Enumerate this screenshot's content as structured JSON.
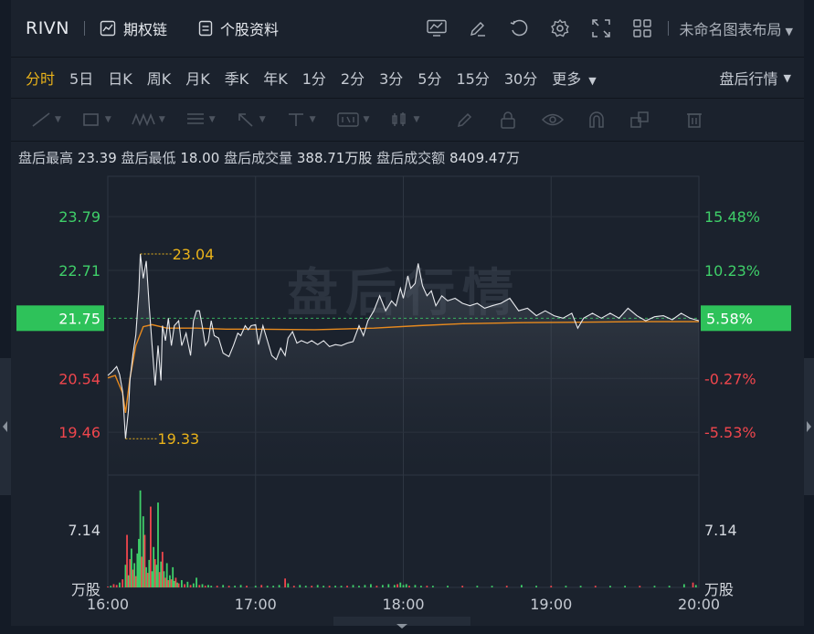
{
  "header": {
    "symbol": "RIVN",
    "options_chain": "期权链",
    "profile": "个股资料",
    "layout_name": "未命名图表布局",
    "icons": [
      "chart-icon",
      "edit-icon",
      "refresh-icon",
      "gear-icon",
      "fullscreen-icon",
      "grid-icon"
    ]
  },
  "periods": {
    "items": [
      "分时",
      "5日",
      "日K",
      "周K",
      "月K",
      "季K",
      "年K",
      "1分",
      "2分",
      "3分",
      "5分",
      "15分",
      "30分"
    ],
    "active": "分时",
    "more": "更多",
    "session": "盘后行情"
  },
  "tools": [
    "line-tool-icon",
    "rect-tool-icon",
    "wave-tool-icon",
    "fib-tool-icon",
    "arrow-tool-icon",
    "text-tool-icon",
    "number-tool-icon",
    "candle-tool-icon",
    "pen-icon",
    "lock-icon",
    "eye-icon",
    "magnet-icon",
    "layers-icon",
    "trash-icon"
  ],
  "stats": {
    "high_label": "盘后最高",
    "high": "23.39",
    "low_label": "盘后最低",
    "low": "18.00",
    "vol_label": "盘后成交量",
    "vol": "388.71万股",
    "amt_label": "盘后成交额",
    "amt": "8409.47万"
  },
  "watermark": "盘后行情",
  "colors": {
    "up": "#3fcf69",
    "down": "#f0464d",
    "price": "#e8eaee",
    "avg": "#e88a1e",
    "annotation": "#e9b21a",
    "tag_bg": "#2ec25a"
  },
  "chart_data": {
    "type": "line",
    "title": "",
    "x_ticks": [
      "16:00",
      "17:00",
      "18:00",
      "19:00",
      "20:00"
    ],
    "price_ticks_left": [
      {
        "value": 23.79,
        "label": "23.79",
        "color": "up"
      },
      {
        "value": 22.71,
        "label": "22.71",
        "color": "up"
      },
      {
        "value": 21.75,
        "label": "21.75",
        "color": "tag"
      },
      {
        "value": 20.54,
        "label": "20.54",
        "color": "down"
      },
      {
        "value": 19.46,
        "label": "19.46",
        "color": "down"
      }
    ],
    "pct_ticks_right": [
      {
        "value": 23.79,
        "label": "15.48%",
        "color": "up"
      },
      {
        "value": 22.71,
        "label": "10.23%",
        "color": "up"
      },
      {
        "value": 21.75,
        "label": "5.58%",
        "color": "tag"
      },
      {
        "value": 20.54,
        "label": "-0.27%",
        "color": "down"
      },
      {
        "value": 19.46,
        "label": "-5.53%",
        "color": "down"
      }
    ],
    "ref_price": 21.75,
    "price_range": [
      18.6,
      24.6
    ],
    "annotations": [
      {
        "label": "23.04",
        "t": 16.22,
        "value": 23.04
      },
      {
        "label": "19.33",
        "t": 16.12,
        "value": 19.33
      }
    ],
    "price_series": {
      "name": "",
      "points": [
        [
          16.0,
          20.6
        ],
        [
          16.03,
          20.68
        ],
        [
          16.06,
          20.78
        ],
        [
          16.08,
          20.62
        ],
        [
          16.1,
          20.28
        ],
        [
          16.12,
          19.33
        ],
        [
          16.14,
          19.9
        ],
        [
          16.15,
          20.52
        ],
        [
          16.17,
          21.02
        ],
        [
          16.19,
          21.42
        ],
        [
          16.21,
          22.3
        ],
        [
          16.22,
          23.04
        ],
        [
          16.24,
          22.55
        ],
        [
          16.26,
          22.9
        ],
        [
          16.28,
          22.0
        ],
        [
          16.3,
          21.2
        ],
        [
          16.32,
          20.4
        ],
        [
          16.34,
          21.2
        ],
        [
          16.36,
          20.5
        ],
        [
          16.37,
          21.6
        ],
        [
          16.39,
          21.3
        ],
        [
          16.41,
          21.75
        ],
        [
          16.43,
          21.2
        ],
        [
          16.45,
          21.6
        ],
        [
          16.48,
          21.7
        ],
        [
          16.5,
          21.2
        ],
        [
          16.53,
          21.45
        ],
        [
          16.56,
          21.0
        ],
        [
          16.58,
          21.7
        ],
        [
          16.6,
          21.9
        ],
        [
          16.62,
          21.9
        ],
        [
          16.64,
          21.58
        ],
        [
          16.66,
          21.2
        ],
        [
          16.68,
          21.3
        ],
        [
          16.7,
          21.7
        ],
        [
          16.72,
          21.4
        ],
        [
          16.75,
          21.35
        ],
        [
          16.78,
          21.05
        ],
        [
          16.82,
          20.98
        ],
        [
          16.85,
          21.2
        ],
        [
          16.88,
          21.45
        ],
        [
          16.9,
          21.4
        ],
        [
          16.93,
          21.6
        ],
        [
          16.95,
          21.52
        ],
        [
          16.97,
          21.6
        ],
        [
          17.0,
          21.62
        ],
        [
          17.02,
          21.22
        ],
        [
          17.05,
          21.6
        ],
        [
          17.08,
          21.3
        ],
        [
          17.11,
          21.0
        ],
        [
          17.14,
          20.92
        ],
        [
          17.17,
          21.15
        ],
        [
          17.2,
          21.0
        ],
        [
          17.22,
          21.35
        ],
        [
          17.25,
          21.48
        ],
        [
          17.28,
          21.25
        ],
        [
          17.31,
          21.3
        ],
        [
          17.35,
          21.25
        ],
        [
          17.38,
          21.3
        ],
        [
          17.42,
          21.22
        ],
        [
          17.46,
          21.3
        ],
        [
          17.5,
          21.18
        ],
        [
          17.54,
          21.22
        ],
        [
          17.58,
          21.2
        ],
        [
          17.62,
          21.25
        ],
        [
          17.66,
          21.28
        ],
        [
          17.7,
          21.6
        ],
        [
          17.73,
          21.4
        ],
        [
          17.76,
          21.7
        ],
        [
          17.8,
          21.9
        ],
        [
          17.84,
          22.2
        ],
        [
          17.88,
          21.9
        ],
        [
          17.92,
          22.1
        ],
        [
          17.95,
          22.0
        ],
        [
          17.98,
          22.35
        ],
        [
          18.0,
          22.15
        ],
        [
          18.03,
          22.6
        ],
        [
          18.05,
          22.35
        ],
        [
          18.08,
          22.45
        ],
        [
          18.1,
          22.85
        ],
        [
          18.13,
          22.4
        ],
        [
          18.16,
          22.2
        ],
        [
          18.19,
          22.3
        ],
        [
          18.22,
          22.0
        ],
        [
          18.26,
          22.2
        ],
        [
          18.3,
          22.1
        ],
        [
          18.35,
          22.15
        ],
        [
          18.4,
          22.05
        ],
        [
          18.45,
          22.0
        ],
        [
          18.5,
          22.05
        ],
        [
          18.55,
          21.95
        ],
        [
          18.6,
          22.0
        ],
        [
          18.66,
          22.05
        ],
        [
          18.72,
          22.15
        ],
        [
          18.78,
          21.9
        ],
        [
          18.84,
          21.95
        ],
        [
          18.9,
          21.8
        ],
        [
          18.96,
          21.9
        ],
        [
          19.02,
          21.8
        ],
        [
          19.08,
          21.75
        ],
        [
          19.14,
          21.85
        ],
        [
          19.18,
          21.55
        ],
        [
          19.22,
          21.75
        ],
        [
          19.28,
          21.85
        ],
        [
          19.34,
          21.75
        ],
        [
          19.4,
          21.85
        ],
        [
          19.46,
          21.75
        ],
        [
          19.52,
          21.95
        ],
        [
          19.58,
          21.8
        ],
        [
          19.64,
          21.7
        ],
        [
          19.7,
          21.78
        ],
        [
          19.76,
          21.8
        ],
        [
          19.82,
          21.72
        ],
        [
          19.88,
          21.85
        ],
        [
          19.94,
          21.75
        ],
        [
          20.0,
          21.7
        ]
      ]
    },
    "avg_series": {
      "name": "",
      "points": [
        [
          16.0,
          20.55
        ],
        [
          16.05,
          20.6
        ],
        [
          16.1,
          20.25
        ],
        [
          16.12,
          19.85
        ],
        [
          16.15,
          20.55
        ],
        [
          16.19,
          21.2
        ],
        [
          16.24,
          21.58
        ],
        [
          16.3,
          21.62
        ],
        [
          16.4,
          21.55
        ],
        [
          16.6,
          21.55
        ],
        [
          16.8,
          21.53
        ],
        [
          17.0,
          21.53
        ],
        [
          17.4,
          21.52
        ],
        [
          17.8,
          21.55
        ],
        [
          18.1,
          21.6
        ],
        [
          18.4,
          21.64
        ],
        [
          18.8,
          21.66
        ],
        [
          19.2,
          21.67
        ],
        [
          19.6,
          21.68
        ],
        [
          20.0,
          21.68
        ]
      ]
    },
    "volume": {
      "unit_label": "万股",
      "tick": {
        "value": 7.14,
        "label": "7.14"
      },
      "max": 13,
      "bars": [
        [
          16.0,
          0.1,
          "down"
        ],
        [
          16.02,
          0.2,
          "up"
        ],
        [
          16.04,
          0.4,
          "down"
        ],
        [
          16.06,
          0.3,
          "down"
        ],
        [
          16.08,
          0.6,
          "up"
        ],
        [
          16.1,
          1.0,
          "down"
        ],
        [
          16.12,
          2.8,
          "up"
        ],
        [
          16.13,
          6.5,
          "down"
        ],
        [
          16.14,
          1.5,
          "up"
        ],
        [
          16.15,
          3.5,
          "down"
        ],
        [
          16.16,
          4.8,
          "up"
        ],
        [
          16.17,
          2.2,
          "down"
        ],
        [
          16.18,
          3.0,
          "up"
        ],
        [
          16.19,
          1.4,
          "down"
        ],
        [
          16.2,
          4.2,
          "up"
        ],
        [
          16.21,
          6.0,
          "up"
        ],
        [
          16.22,
          12.0,
          "up"
        ],
        [
          16.23,
          3.8,
          "down"
        ],
        [
          16.24,
          8.8,
          "up"
        ],
        [
          16.25,
          6.5,
          "down"
        ],
        [
          16.26,
          2.5,
          "up"
        ],
        [
          16.27,
          1.8,
          "down"
        ],
        [
          16.28,
          3.4,
          "up"
        ],
        [
          16.29,
          10.0,
          "down"
        ],
        [
          16.3,
          2.0,
          "up"
        ],
        [
          16.31,
          5.0,
          "up"
        ],
        [
          16.32,
          3.5,
          "down"
        ],
        [
          16.33,
          2.8,
          "up"
        ],
        [
          16.34,
          10.5,
          "up"
        ],
        [
          16.35,
          1.9,
          "down"
        ],
        [
          16.36,
          3.2,
          "up"
        ],
        [
          16.37,
          4.4,
          "down"
        ],
        [
          16.38,
          2.0,
          "up"
        ],
        [
          16.39,
          1.2,
          "down"
        ],
        [
          16.4,
          3.0,
          "up"
        ],
        [
          16.41,
          0.9,
          "down"
        ],
        [
          16.42,
          1.5,
          "up"
        ],
        [
          16.43,
          1.0,
          "down"
        ],
        [
          16.44,
          2.5,
          "up"
        ],
        [
          16.45,
          0.8,
          "up"
        ],
        [
          16.46,
          1.2,
          "down"
        ],
        [
          16.47,
          0.6,
          "up"
        ],
        [
          16.48,
          0.5,
          "down"
        ],
        [
          16.5,
          0.9,
          "up"
        ],
        [
          16.52,
          0.4,
          "down"
        ],
        [
          16.54,
          0.7,
          "up"
        ],
        [
          16.56,
          0.3,
          "down"
        ],
        [
          16.58,
          0.5,
          "up"
        ],
        [
          16.6,
          1.2,
          "up"
        ],
        [
          16.62,
          0.3,
          "down"
        ],
        [
          16.64,
          0.4,
          "up"
        ],
        [
          16.66,
          0.2,
          "down"
        ],
        [
          16.68,
          0.3,
          "up"
        ],
        [
          16.7,
          0.2,
          "up"
        ],
        [
          16.74,
          0.2,
          "down"
        ],
        [
          16.78,
          0.3,
          "up"
        ],
        [
          16.82,
          0.2,
          "down"
        ],
        [
          16.86,
          0.2,
          "up"
        ],
        [
          16.9,
          0.3,
          "up"
        ],
        [
          16.94,
          0.2,
          "down"
        ],
        [
          17.0,
          0.2,
          "up"
        ],
        [
          17.04,
          0.3,
          "down"
        ],
        [
          17.08,
          0.2,
          "up"
        ],
        [
          17.12,
          0.2,
          "up"
        ],
        [
          17.16,
          0.3,
          "up"
        ],
        [
          17.2,
          1.1,
          "down"
        ],
        [
          17.22,
          0.5,
          "up"
        ],
        [
          17.26,
          0.2,
          "down"
        ],
        [
          17.3,
          0.3,
          "up"
        ],
        [
          17.34,
          0.2,
          "up"
        ],
        [
          17.38,
          0.2,
          "down"
        ],
        [
          17.42,
          0.3,
          "up"
        ],
        [
          17.46,
          0.2,
          "up"
        ],
        [
          17.5,
          0.2,
          "down"
        ],
        [
          17.54,
          0.2,
          "up"
        ],
        [
          17.58,
          0.2,
          "up"
        ],
        [
          17.62,
          0.2,
          "down"
        ],
        [
          17.66,
          0.3,
          "up"
        ],
        [
          17.7,
          0.2,
          "up"
        ],
        [
          17.74,
          0.3,
          "up"
        ],
        [
          17.78,
          0.4,
          "up"
        ],
        [
          17.82,
          0.2,
          "down"
        ],
        [
          17.86,
          0.3,
          "up"
        ],
        [
          17.9,
          0.4,
          "up"
        ],
        [
          17.94,
          0.3,
          "up"
        ],
        [
          17.96,
          0.4,
          "down"
        ],
        [
          17.98,
          0.6,
          "up"
        ],
        [
          18.0,
          0.3,
          "up"
        ],
        [
          18.02,
          0.4,
          "up"
        ],
        [
          18.04,
          0.2,
          "down"
        ],
        [
          18.08,
          0.3,
          "up"
        ],
        [
          18.12,
          0.2,
          "up"
        ],
        [
          18.16,
          0.2,
          "down"
        ],
        [
          18.2,
          0.2,
          "up"
        ],
        [
          18.3,
          0.2,
          "up"
        ],
        [
          18.4,
          0.2,
          "down"
        ],
        [
          18.5,
          0.2,
          "up"
        ],
        [
          18.6,
          0.2,
          "up"
        ],
        [
          18.7,
          0.2,
          "down"
        ],
        [
          18.8,
          0.3,
          "up"
        ],
        [
          18.9,
          0.2,
          "up"
        ],
        [
          19.0,
          0.2,
          "down"
        ],
        [
          19.1,
          0.2,
          "up"
        ],
        [
          19.2,
          0.2,
          "up"
        ],
        [
          19.3,
          0.2,
          "down"
        ],
        [
          19.4,
          0.2,
          "up"
        ],
        [
          19.5,
          0.2,
          "up"
        ],
        [
          19.6,
          0.2,
          "down"
        ],
        [
          19.7,
          0.2,
          "up"
        ],
        [
          19.8,
          0.2,
          "up"
        ],
        [
          19.9,
          0.4,
          "up"
        ],
        [
          19.96,
          0.6,
          "down"
        ],
        [
          19.98,
          0.3,
          "up"
        ]
      ]
    }
  }
}
